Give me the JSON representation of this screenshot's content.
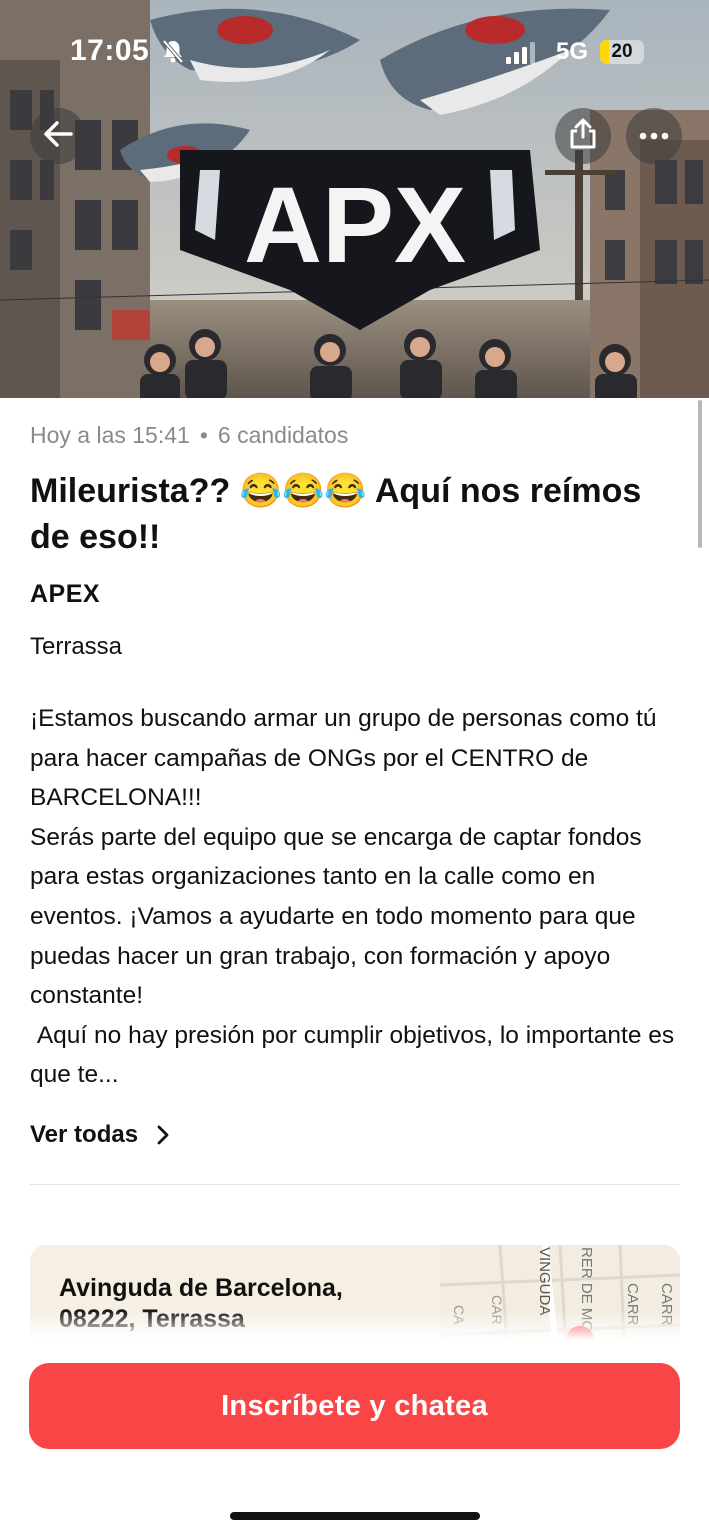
{
  "status_bar": {
    "time": "17:05",
    "network": "5G",
    "battery_level": "20",
    "battery_fraction": 0.2,
    "battery_color": "#ffd60a"
  },
  "hero": {
    "logo_text": "APX",
    "icons": {
      "back": "back-arrow-icon",
      "share": "share-icon",
      "more": "more-icon"
    }
  },
  "job": {
    "posted": "Hoy a las 15:41",
    "separator": "•",
    "candidates": "6 candidatos",
    "title": "Mileurista?? 😂😂😂 Aquí nos reímos de eso!!",
    "company": "APEX",
    "city": "Terrassa",
    "description": "¡Estamos buscando armar un grupo de personas como tú para hacer campañas de ONGs por el CENTRO de BARCELONA!!!\nSerás parte del equipo que se encarga de captar fondos para estas organizaciones tanto en la calle como en eventos. ¡Vamos a ayudarte en todo momento para que puedas hacer un gran trabajo, con formación y apoyo constante!\n Aquí no hay presión por cumplir objetivos, lo importante es que te...",
    "see_all": "Ver todas"
  },
  "location": {
    "address_line1": "Avinguda de Barcelona,",
    "address_line2": "08222, Terrassa",
    "map_labels": [
      "VINGUDA",
      "RER DE MO",
      "CARR",
      "CARR",
      "CAR",
      "CA"
    ]
  },
  "cta": {
    "label": "Inscríbete y chatea",
    "color": "#f94545"
  }
}
